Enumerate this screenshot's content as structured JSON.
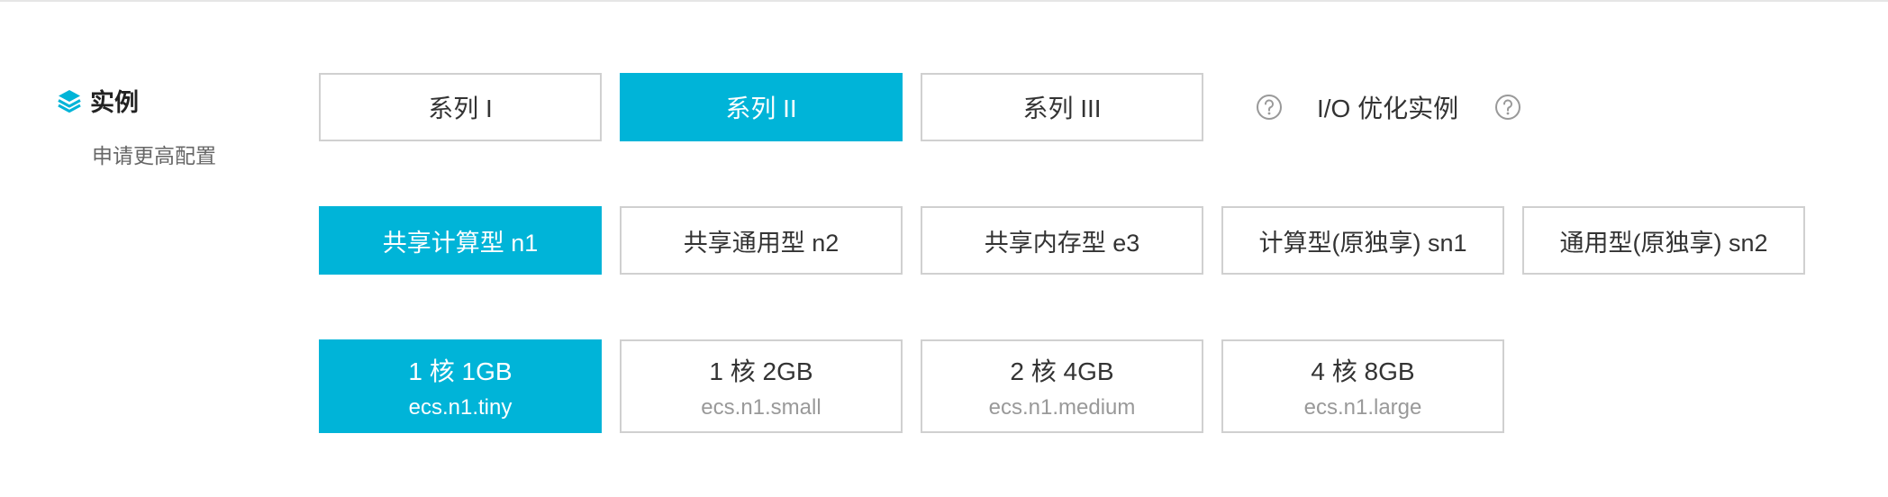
{
  "section": {
    "icon": "layers-icon",
    "title": "实例",
    "subtitle": "申请更高配置"
  },
  "accent_color": "#00b4d8",
  "series": {
    "options": [
      {
        "label": "系列 I",
        "selected": false
      },
      {
        "label": "系列 II",
        "selected": true
      },
      {
        "label": "系列 III",
        "selected": false
      }
    ],
    "io_label": "I/O 优化实例",
    "help_icon": "question-circle-icon"
  },
  "families": {
    "options": [
      {
        "label": "共享计算型 n1",
        "selected": true
      },
      {
        "label": "共享通用型 n2",
        "selected": false
      },
      {
        "label": "共享内存型 e3",
        "selected": false
      },
      {
        "label": "计算型(原独享) sn1",
        "selected": false
      },
      {
        "label": "通用型(原独享) sn2",
        "selected": false
      }
    ]
  },
  "specs": {
    "options": [
      {
        "title": "1 核 1GB",
        "code": "ecs.n1.tiny",
        "selected": true
      },
      {
        "title": "1 核 2GB",
        "code": "ecs.n1.small",
        "selected": false
      },
      {
        "title": "2 核 4GB",
        "code": "ecs.n1.medium",
        "selected": false
      },
      {
        "title": "4 核 8GB",
        "code": "ecs.n1.large",
        "selected": false
      }
    ]
  }
}
